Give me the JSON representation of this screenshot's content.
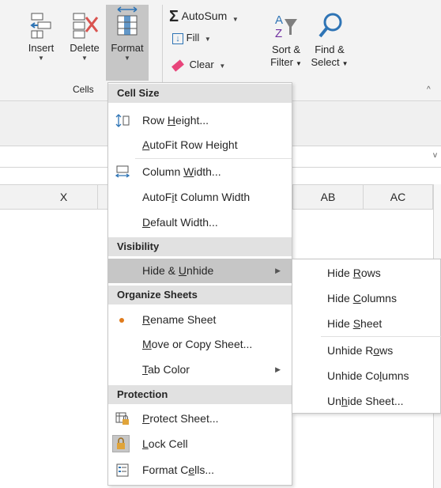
{
  "ribbon": {
    "insert_label": "Insert",
    "delete_label": "Delete",
    "format_label": "Format",
    "cells_group_label": "Cells",
    "autosum_label": "AutoSum",
    "fill_label": "Fill",
    "clear_label": "Clear",
    "sort_filter_line1": "Sort &",
    "sort_filter_line2": "Filter",
    "find_select_line1": "Find &",
    "find_select_line2": "Select"
  },
  "columns": {
    "x": "X",
    "ab": "AB",
    "ac": "AC"
  },
  "format_menu": {
    "section_cell_size": "Cell Size",
    "row_height": {
      "pre": "Row ",
      "acc": "H",
      "post": "eight..."
    },
    "autofit_row": {
      "pre": "",
      "acc": "A",
      "post": "utoFit Row Height"
    },
    "column_width": {
      "pre": "Column ",
      "acc": "W",
      "post": "idth..."
    },
    "autofit_column": {
      "pre": "AutoF",
      "acc": "i",
      "post": "t Column Width"
    },
    "default_width": {
      "pre": "",
      "acc": "D",
      "post": "efault Width..."
    },
    "section_visibility": "Visibility",
    "hide_unhide": {
      "pre": "Hide & ",
      "acc": "U",
      "post": "nhide"
    },
    "section_organize": "Organize Sheets",
    "rename_sheet": {
      "pre": "",
      "acc": "R",
      "post": "ename Sheet"
    },
    "move_copy": {
      "pre": "",
      "acc": "M",
      "post": "ove or Copy Sheet..."
    },
    "tab_color": {
      "pre": "",
      "acc": "T",
      "post": "ab Color"
    },
    "section_protection": "Protection",
    "protect_sheet": {
      "pre": "",
      "acc": "P",
      "post": "rotect Sheet..."
    },
    "lock_cell": {
      "pre": "",
      "acc": "L",
      "post": "ock Cell"
    },
    "format_cells": {
      "pre": "Format C",
      "acc": "e",
      "post": "lls..."
    }
  },
  "hide_submenu": {
    "hide_rows": {
      "pre": "Hide ",
      "acc": "R",
      "post": "ows"
    },
    "hide_columns": {
      "pre": "Hide ",
      "acc": "C",
      "post": "olumns"
    },
    "hide_sheet": {
      "pre": "Hide ",
      "acc": "S",
      "post": "heet"
    },
    "unhide_rows": {
      "pre": "Unhide R",
      "acc": "o",
      "post": "ws"
    },
    "unhide_columns": {
      "pre": "Unhide Co",
      "acc": "l",
      "post": "umns"
    },
    "unhide_sheet": {
      "pre": "Un",
      "acc": "h",
      "post": "ide Sheet..."
    }
  },
  "colors": {
    "highlight": "#c6c6c6",
    "section_header_bg": "#e1e1e1",
    "bullet": "#e07b1c",
    "find_icon": "#2e74b5",
    "clear_icon": "#e8457b"
  }
}
